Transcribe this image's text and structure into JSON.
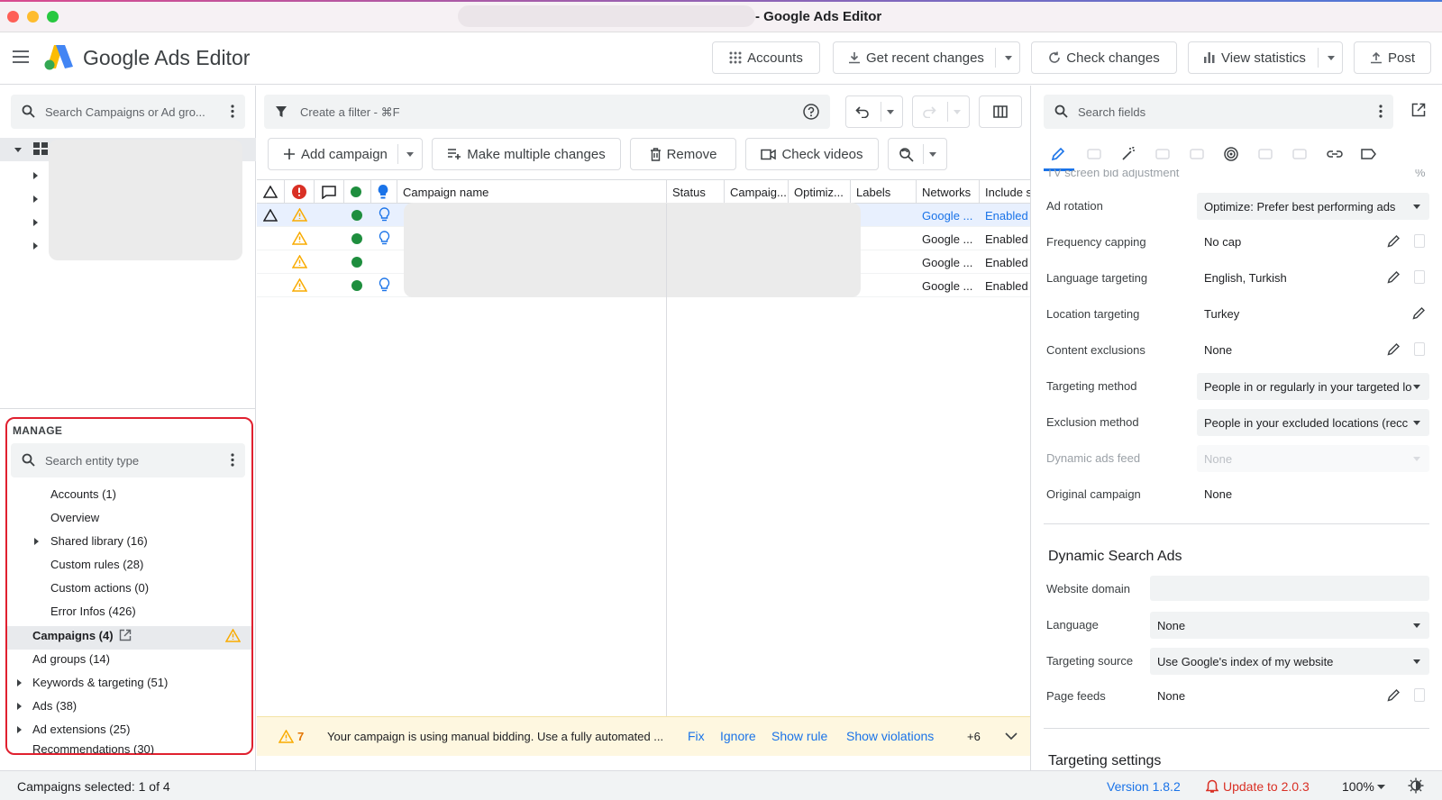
{
  "window": {
    "title": "- Google Ads Editor"
  },
  "header": {
    "app_name": "Google Ads Editor",
    "accounts": "Accounts",
    "get_recent_changes": "Get recent changes",
    "check_changes": "Check changes",
    "view_statistics": "View statistics",
    "post": "Post"
  },
  "tree": {
    "search_placeholder": "Search Campaigns or Ad gro..."
  },
  "manage": {
    "title": "MANAGE",
    "search_placeholder": "Search entity type",
    "items": [
      "Accounts (1)",
      "Overview",
      "Shared library (16)",
      "Custom rules (28)",
      "Custom actions (0)",
      "Error Infos (426)",
      "Campaigns (4)",
      "Ad groups (14)",
      "Keywords & targeting (51)",
      "Ads (38)",
      "Ad extensions (25)",
      "Recommendations (30)"
    ]
  },
  "filter": {
    "placeholder": "Create a filter - ⌘F"
  },
  "toolbar": {
    "add_campaign": "Add campaign",
    "make_multiple_changes": "Make multiple changes",
    "remove": "Remove",
    "check_videos": "Check videos"
  },
  "grid": {
    "columns": [
      "Campaign name",
      "Status",
      "Campaig...",
      "Optimiz...",
      "Labels",
      "Networks",
      "Include s"
    ],
    "rows": [
      {
        "networks": "Google ...",
        "include": "Enabled"
      },
      {
        "networks": "Google ...",
        "include": "Enabled"
      },
      {
        "networks": "Google ...",
        "include": "Enabled"
      },
      {
        "networks": "Google ...",
        "include": "Enabled"
      }
    ]
  },
  "notification": {
    "count": "7",
    "message": "Your campaign is using manual bidding. Use a fully automated ...",
    "fix": "Fix",
    "ignore": "Ignore",
    "show_rule": "Show rule",
    "show_violations": "Show violations",
    "more": "+6"
  },
  "properties": {
    "search_placeholder": "Search fields",
    "cut_label": "TV screen bid adjustment",
    "cut_unit": "%",
    "ad_rotation_label": "Ad rotation",
    "ad_rotation_value": "Optimize: Prefer best performing ads",
    "frequency_capping_label": "Frequency capping",
    "frequency_capping_value": "No cap",
    "language_targeting_label": "Language targeting",
    "language_targeting_value": "English, Turkish",
    "location_targeting_label": "Location targeting",
    "location_targeting_value": "Turkey",
    "content_exclusions_label": "Content exclusions",
    "content_exclusions_value": "None",
    "targeting_method_label": "Targeting method",
    "targeting_method_value": "People in or regularly in your targeted lo",
    "exclusion_method_label": "Exclusion method",
    "exclusion_method_value": "People in your excluded locations (recc",
    "dynamic_ads_feed_label": "Dynamic ads feed",
    "dynamic_ads_feed_value": "None",
    "original_campaign_label": "Original campaign",
    "original_campaign_value": "None",
    "dsa_title": "Dynamic Search Ads",
    "website_domain_label": "Website domain",
    "language_label": "Language",
    "language_value": "None",
    "targeting_source_label": "Targeting source",
    "targeting_source_value": "Use Google's index of my website",
    "page_feeds_label": "Page feeds",
    "page_feeds_value": "None",
    "targeting_settings_title": "Targeting settings"
  },
  "status": {
    "selected": "Campaigns selected: 1 of 4",
    "version": "Version 1.8.2",
    "update": "Update to 2.0.3",
    "zoom": "100%"
  },
  "colors": {
    "accent": "#1a73e8",
    "error": "#d93025",
    "warning": "#f9ab00",
    "ok": "#1e8e3e",
    "highlight": "#e0202f"
  }
}
